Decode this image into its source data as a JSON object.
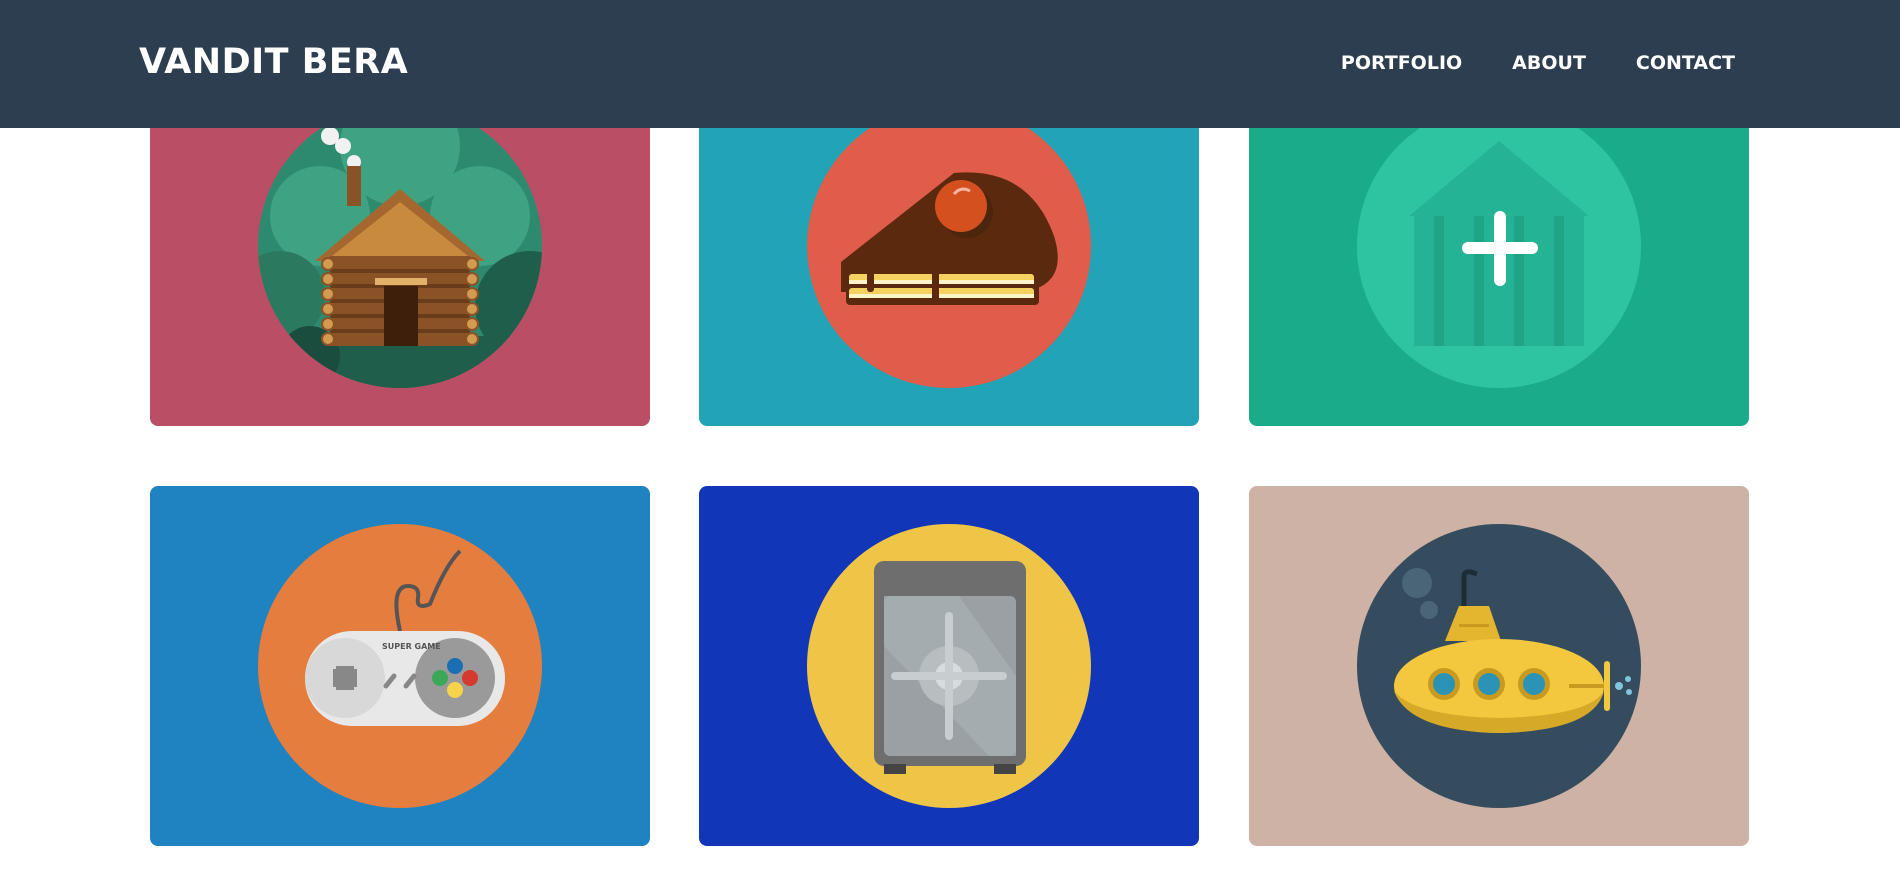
{
  "header": {
    "brand": "VANDIT BERA",
    "nav": [
      {
        "label": "PORTFOLIO"
      },
      {
        "label": "ABOUT"
      },
      {
        "label": "CONTACT"
      }
    ]
  },
  "portfolio": {
    "items": [
      {
        "icon": "cabin-icon",
        "bg_color": "#ba4e64",
        "circle_color": "#2e8a6e"
      },
      {
        "icon": "cake-icon",
        "bg_color": "#22a3b6",
        "circle_color": "#e05c4b"
      },
      {
        "icon": "circus-tent-icon",
        "bg_color": "#1aab8a",
        "circle_color": "#2ec4a2",
        "overlay_icon": "plus-icon"
      },
      {
        "icon": "game-controller-icon",
        "bg_color": "#1f83c2",
        "circle_color": "#e47d3d"
      },
      {
        "icon": "safe-icon",
        "bg_color": "#1136b7",
        "circle_color": "#efc547"
      },
      {
        "icon": "submarine-icon",
        "bg_color": "#cdb2a5",
        "circle_color": "#354c5e"
      }
    ]
  }
}
